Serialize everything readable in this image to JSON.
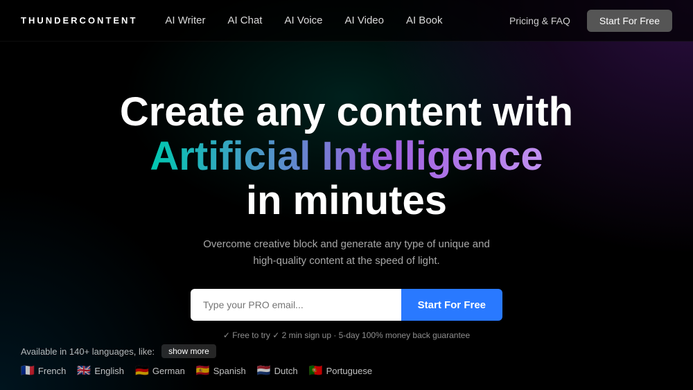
{
  "logo": {
    "text": "THUNDERCONTENT"
  },
  "nav": {
    "links": [
      {
        "label": "AI Writer",
        "name": "ai-writer"
      },
      {
        "label": "AI Chat",
        "name": "ai-chat"
      },
      {
        "label": "AI Voice",
        "name": "ai-voice"
      },
      {
        "label": "AI Video",
        "name": "ai-video"
      },
      {
        "label": "AI Book",
        "name": "ai-book"
      }
    ],
    "pricing_label": "Pricing & FAQ",
    "cta_label": "Start For Free"
  },
  "hero": {
    "line1": "Create any content with",
    "line2": "Artificial Intelligence",
    "line3": "in minutes",
    "subtitle_line1": "Overcome creative block and generate any type of unique and",
    "subtitle_line2": "high-quality content at the speed of light.",
    "email_placeholder": "Type your PRO email...",
    "cta_label": "Start For Free",
    "guarantee": "✓ Free to try ✓ 2 min sign up · 5-day 100% money back guarantee"
  },
  "languages": {
    "available_text": "Available in 140+ languages, like:",
    "show_more_label": "show more",
    "items": [
      {
        "flag": "🇫🇷",
        "name": "French"
      },
      {
        "flag": "🇬🇧",
        "name": "English"
      },
      {
        "flag": "🇩🇪",
        "name": "German"
      },
      {
        "flag": "🇪🇸",
        "name": "Spanish"
      },
      {
        "flag": "🇳🇱",
        "name": "Dutch"
      },
      {
        "flag": "🇵🇹",
        "name": "Portuguese"
      }
    ]
  }
}
